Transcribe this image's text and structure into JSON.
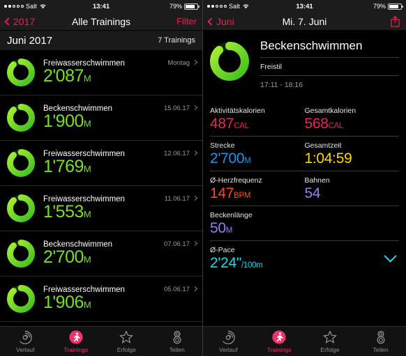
{
  "status_bar": {
    "signal_dots_filled": 2,
    "signal_dots_total": 5,
    "carrier": "Salt",
    "wifi_icon": "wifi-icon",
    "time": "13:41",
    "battery_percent": "79%",
    "battery_level": 79
  },
  "left_screen": {
    "nav": {
      "back_label": "2017",
      "back_icon": "chevron-left-icon",
      "title": "Alle Trainings",
      "action_label": "Filter"
    },
    "section": {
      "title": "Juni 2017",
      "count": "7 Trainings"
    },
    "workouts": [
      {
        "title": "Freiwasserschwimmen",
        "date": "Montag",
        "value": "2'087",
        "unit": "M",
        "ring_progress": 88
      },
      {
        "title": "Beckenschwimmen",
        "date": "15.06.17",
        "value": "1'900",
        "unit": "M",
        "ring_progress": 88
      },
      {
        "title": "Freiwasserschwimmen",
        "date": "12.06.17",
        "value": "1'769",
        "unit": "M",
        "ring_progress": 88
      },
      {
        "title": "Freiwasserschwimmen",
        "date": "11.06.17",
        "value": "1'553",
        "unit": "M",
        "ring_progress": 88
      },
      {
        "title": "Beckenschwimmen",
        "date": "07.06.17",
        "value": "2'700",
        "unit": "M",
        "ring_progress": 88
      },
      {
        "title": "Freiwasserschwimmen",
        "date": "05.06.17",
        "value": "1'906",
        "unit": "M",
        "ring_progress": 88
      }
    ]
  },
  "right_screen": {
    "nav": {
      "back_label": "Juni",
      "back_icon": "chevron-left-icon",
      "title": "Mi. 7. Juni",
      "action_icon": "share-icon"
    },
    "header": {
      "ring_progress": 88,
      "title": "Beckenschwimmen",
      "style": "Freistil",
      "time_range": "17:11 - 18:16"
    },
    "stats": [
      [
        {
          "label": "Aktivitätskalorien",
          "value": "487",
          "unit": "CAL",
          "color": "#e8245b"
        },
        {
          "label": "Gesamtkalorien",
          "value": "568",
          "unit": "CAL",
          "color": "#e8245b"
        }
      ],
      [
        {
          "label": "Strecke",
          "value": "2'700",
          "unit": "M",
          "color": "#2196e8"
        },
        {
          "label": "Gesamtzeit",
          "value": "1:04:59",
          "unit": "",
          "color": "#ffd60a"
        }
      ],
      [
        {
          "label": "Ø-Herzfrequenz",
          "value": "147",
          "unit": "BPM",
          "color": "#ff4b1f"
        },
        {
          "label": "Bahnen",
          "value": "54",
          "unit": "",
          "color": "#8f7ff0"
        }
      ],
      [
        {
          "label": "Beckenlänge",
          "value": "50",
          "unit": "M",
          "color": "#8f7ff0"
        }
      ],
      [
        {
          "label": "Ø-Pace",
          "value": "2'24\"",
          "unit": "/100m",
          "color": "#22d7e8",
          "expand_icon": "chevron-down-icon"
        }
      ]
    ]
  },
  "tab_bar": {
    "items": [
      {
        "label": "Verlauf",
        "icon": "history-rings-icon",
        "active": false
      },
      {
        "label": "Trainings",
        "icon": "running-person-icon",
        "active": true
      },
      {
        "label": "Erfolge",
        "icon": "star-icon",
        "active": false
      },
      {
        "label": "Teilen",
        "icon": "share-people-icon",
        "active": false
      }
    ]
  },
  "colors": {
    "accent_pink": "#f0326a",
    "nav_tint": "#e0244f",
    "ring_green_light": "#a8f033",
    "ring_green_dark": "#3fbf20",
    "value_green": "#76e025",
    "background": "#000000"
  }
}
